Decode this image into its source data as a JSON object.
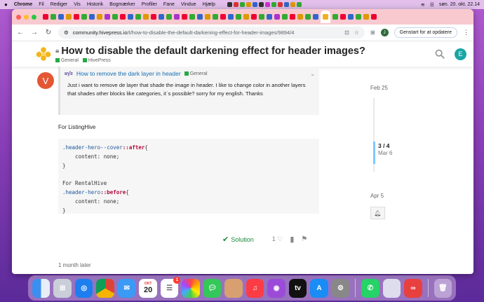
{
  "menubar": {
    "app": "Chrome",
    "items": [
      "Fil",
      "Rediger",
      "Vis",
      "Historik",
      "Bogmærker",
      "Profiler",
      "Fane",
      "Vindue",
      "Hjælp"
    ],
    "clock": "søn. 20. okt. 22.14"
  },
  "browser": {
    "url_host": "community.hivepress.io",
    "url_path": "/t/how-to-disable-the-default-darkening-effect-for-header-images/9894/4",
    "profile_initial": "J",
    "update_label": "Genstart for at opdatere"
  },
  "header": {
    "title": "How to disable the default darkening effect for header images?",
    "categories": [
      {
        "name": "General",
        "color": "#25aa44"
      },
      {
        "name": "HivePress",
        "color": "#25aa44"
      }
    ],
    "user_initial": "E"
  },
  "post": {
    "avatar_initial": "V",
    "quote": {
      "user_avatar_text": "ʁƴƨ",
      "title": "How to remove the dark layer in header",
      "category": "General",
      "body": "Just i want to remove de layer that shade the image in header. I like to change color in another layers that shades other blocks like categories, it´s possible? sorry for my english. Thanks"
    },
    "for_label": "For ListingHive",
    "code": {
      "l1_sel": ".header-hero--cover",
      "l1_pseudo": "::after",
      "l1_brace": "{",
      "l2": "    content: none;",
      "l3": "}",
      "l5": "For RentalHive",
      "l6_sel": ".header-hero",
      "l6_pseudo": "::before",
      "l6_brace": "{",
      "l7": "    content: none;",
      "l8": "}"
    },
    "solution_label": "Solution",
    "like_count": "1"
  },
  "later_label": "1 month later",
  "timeline": {
    "top_date": "Feb 25",
    "count": "3 / 4",
    "current_date": "Mar 6",
    "bottom_date": "Apr 5"
  },
  "dock": {
    "calendar_month": "OKT",
    "calendar_day": "20",
    "reminders_badge": "1"
  },
  "colors": {
    "accent": "#146eb3",
    "solution": "#1a8a3c",
    "avatar_v": "#e45735",
    "avatar_e": "#1aa5a5",
    "tabstrip": "#f8c9cf"
  }
}
